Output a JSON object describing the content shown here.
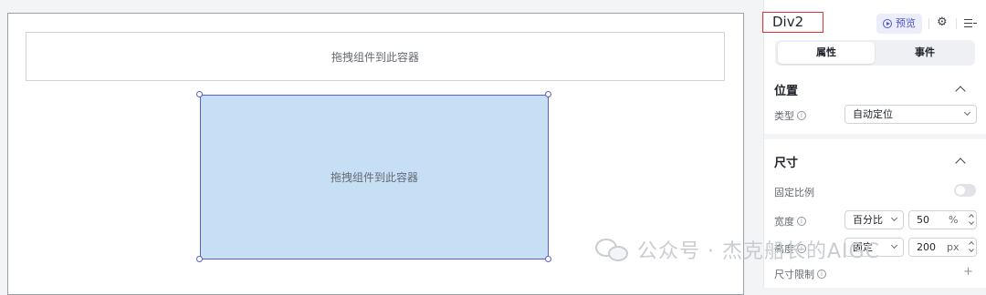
{
  "canvas": {
    "dropzone_top_text": "拖拽组件到此容器",
    "dropzone_selected_text": "拖拽组件到此容器"
  },
  "panel": {
    "component_name": "Div2",
    "preview_label": "预览",
    "tabs": [
      {
        "label": "属性",
        "active": true
      },
      {
        "label": "事件",
        "active": false
      }
    ],
    "position": {
      "title": "位置",
      "type_label": "类型",
      "type_value": "自动定位"
    },
    "size": {
      "title": "尺寸",
      "ratio_label": "固定比例",
      "ratio_enabled": false,
      "width_label": "宽度",
      "width_mode": "百分比",
      "width_value": "50",
      "width_unit": "%",
      "height_label": "高度",
      "height_mode": "固定",
      "height_value": "200",
      "height_unit": "px",
      "limit_label": "尺寸限制"
    }
  },
  "watermark": {
    "text": "公众号 · 杰克船长的AIGC"
  },
  "colors": {
    "accent": "#4e54c8",
    "selection_fill": "#c6dff5",
    "highlight_border": "#e0322f"
  }
}
